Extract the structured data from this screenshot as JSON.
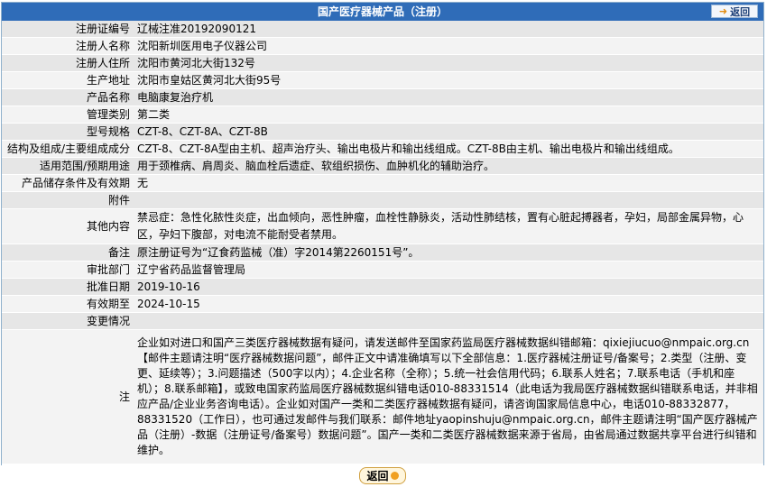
{
  "header": {
    "title": "国产医疗器械产品（注册）",
    "back_label": "返回"
  },
  "fields": [
    {
      "label": "注册证编号",
      "value": "辽械注准20192090121"
    },
    {
      "label": "注册人名称",
      "value": "沈阳新圳医用电子仪器公司"
    },
    {
      "label": "注册人住所",
      "value": "沈阳市黄河北大街132号"
    },
    {
      "label": "生产地址",
      "value": "沈阳市皇姑区黄河北大街95号"
    },
    {
      "label": "产品名称",
      "value": "电脑康复治疗机"
    },
    {
      "label": "管理类别",
      "value": "第二类"
    },
    {
      "label": "型号规格",
      "value": "CZT-8、CZT-8A、CZT-8B"
    },
    {
      "label": "结构及组成/主要组成成分",
      "value": "CZT-8、CZT-8A型由主机、超声治疗头、输出电极片和输出线组成。CZT-8B由主机、输出电极片和输出线组成。"
    },
    {
      "label": "适用范围/预期用途",
      "value": "用于颈椎病、肩周炎、脑血栓后遗症、软组织损伤、血肿机化的辅助治疗。"
    },
    {
      "label": "产品储存条件及有效期",
      "value": "无"
    },
    {
      "label": "附件",
      "value": ""
    },
    {
      "label": "其他内容",
      "value": "禁忌症：急性化脓性炎症，出血倾向，恶性肿瘤，血栓性静脉炎，活动性肺结核，置有心脏起搏器者，孕妇，局部金属异物，心区，孕妇下腹部，对电流不能耐受者禁用。"
    },
    {
      "label": "备注",
      "value": "原注册证号为“辽食药监械（准）字2014第2260151号”。"
    },
    {
      "label": "审批部门",
      "value": "辽宁省药品监督管理局"
    },
    {
      "label": "批准日期",
      "value": "2019-10-16"
    },
    {
      "label": "有效期至",
      "value": "2024-10-15"
    },
    {
      "label": "变更情况",
      "value": ""
    }
  ],
  "note": {
    "label": "注",
    "text": "企业如对进口和国产三类医疗器械数据有疑问，请发送邮件至国家药监局医疗器械数据纠错邮箱：qixiejiucuo@nmpaic.org.cn【邮件主题请注明“医疗器械数据问题”，邮件正文中请准确填写以下全部信息：1.医疗器械注册证号/备案号；2.类型（注册、变更、延续等）；3.问题描述（500字以内）；4.企业名称（全称）；5.统一社会信用代码；6.联系人姓名；7.联系电话（手机和座机）；8.联系邮箱】，或致电国家药监局医疗器械数据纠错电话010-88331514（此电话为我局医疗器械数据纠错联系电话，并非相应产品/企业业务咨询电话）。企业如对国产一类和二类医疗器械数据有疑问，请咨询国家局信息中心，电话010-88332877，88331520（工作日），也可通过发邮件与我们联系：邮件地址yaopinshuju@nmpaic.org.cn，邮件主题请注明“国产医疗器械产品（注册）-数据（注册证号/备案号）数据问题”。国产一类和二类医疗器械数据来源于省局，由省局通过数据共享平台进行纠错和维护。"
  },
  "footer": {
    "back_label": "返回"
  },
  "colors": {
    "header_bg": "#2f6cb8",
    "row_odd": "#e6e6e6",
    "row_even": "#f3f3f3",
    "accent": "#e28d12"
  },
  "icons": {
    "top_back": "arrow-right-icon",
    "bottom_back": "return-icon"
  }
}
